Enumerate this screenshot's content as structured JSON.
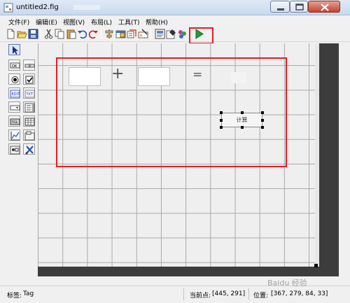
{
  "window": {
    "title": "untitled2.fig",
    "blurred_text": "......"
  },
  "menu": [
    {
      "label": "文件(F)"
    },
    {
      "label": "编辑(E)"
    },
    {
      "label": "视图(V)"
    },
    {
      "label": "布局(L)"
    },
    {
      "label": "工具(T)"
    },
    {
      "label": "帮助(H)"
    }
  ],
  "toolbar": {
    "icons": [
      "new-icon",
      "open-icon",
      "save-icon",
      "cut-icon",
      "copy-icon",
      "paste-icon",
      "undo-icon",
      "redo-icon",
      "align-icon",
      "menu-editor-icon",
      "tab-order-icon",
      "toolbar-editor-icon",
      "mfile-editor-icon",
      "property-inspector-icon",
      "object-browser-icon",
      "run-icon"
    ]
  },
  "palette": {
    "items": [
      "select-tool",
      "push-button-tool",
      "slider-tool",
      "radio-button-tool",
      "checkbox-tool",
      "edit-text-tool",
      "static-text-tool",
      "popup-menu-tool",
      "listbox-tool",
      "toggle-button-tool",
      "table-tool",
      "axes-tool",
      "panel-tool",
      "button-group-tool",
      "activex-tool"
    ]
  },
  "canvas": {
    "plus": "+",
    "equals": "=",
    "calc_button_label": "计算"
  },
  "status": {
    "tag_label": "标签:",
    "tag_value": "Tag",
    "current_point_label": "当前点:",
    "current_point_value": "[445, 291]",
    "position_label": "位置:",
    "position_value": "[367, 279, 84, 33]"
  },
  "watermark": "Baidu 经验",
  "colors": {
    "annotation_red": "#e01f26",
    "run_green": "#1e9e32"
  }
}
